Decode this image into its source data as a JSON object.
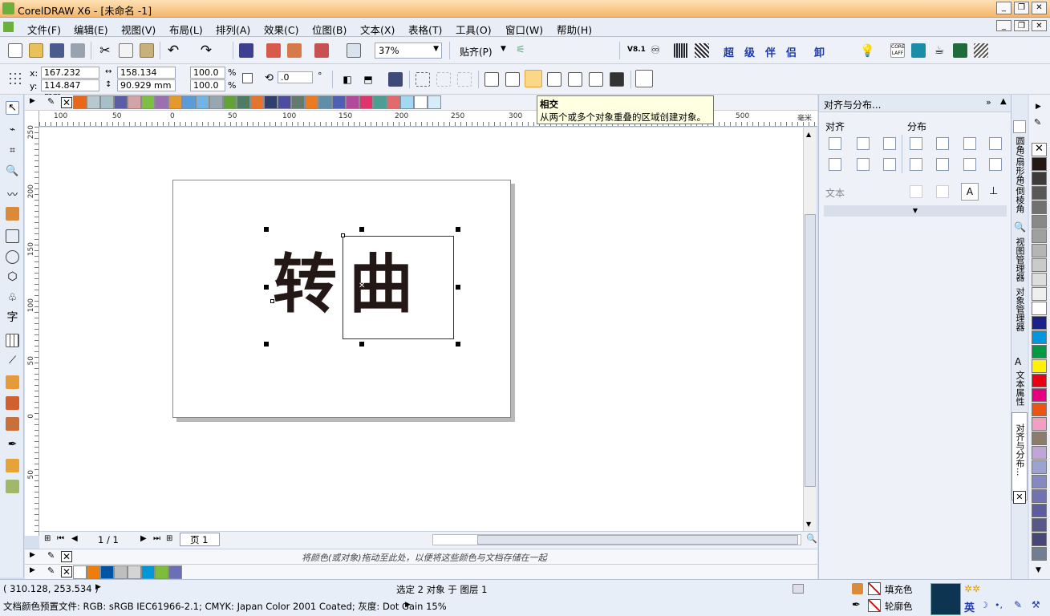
{
  "app": {
    "title": "CorelDRAW X6 - [未命名 -1]"
  },
  "menu": [
    "文件(F)",
    "编辑(E)",
    "视图(V)",
    "布局(L)",
    "排列(A)",
    "效果(C)",
    "位图(B)",
    "文本(X)",
    "表格(T)",
    "工具(O)",
    "窗口(W)",
    "帮助(H)"
  ],
  "toolbar": {
    "zoom": "37%",
    "snap": "贴齐(P)",
    "version_label": "V8.1",
    "char_buttons": [
      "超",
      "级",
      "伴",
      "侣",
      "卸"
    ]
  },
  "property_bar": {
    "x_label": "x:",
    "y_label": "y:",
    "x": "167.232 mm",
    "y": "114.847 mm",
    "width": "158.134 mm",
    "height": "90.929 mm",
    "scale_x": "100.0",
    "scale_y": "100.0",
    "percent": "%",
    "rotation": ".0",
    "degree": "°"
  },
  "hruler_ticks": [
    "100",
    "50",
    "0",
    "50",
    "100",
    "150",
    "200",
    "250",
    "300",
    "500",
    "毫米"
  ],
  "vruler_ticks": [
    "250",
    "200",
    "150",
    "100",
    "50",
    "0",
    "50"
  ],
  "canvas": {
    "char1": "转",
    "char2": "曲"
  },
  "tooltip": {
    "title": "相交",
    "desc": "从两个或多个对象重叠的区域创建对象。"
  },
  "docker": {
    "title": "对齐与分布...",
    "align_label": "对齐",
    "distribute_label": "分布",
    "text_label": "文本"
  },
  "docker_tabs": [
    "圆角/扇形角/倒棱角",
    "视图管理器",
    "对象管理器",
    "文本属性",
    "对齐与分布..."
  ],
  "page": {
    "counter": "1 / 1",
    "tab": "页 1"
  },
  "doc_palette": {
    "hint": "将颜色(或对象)拖动至此处，以便将这些颜色与文档存储在一起"
  },
  "status": {
    "coords": "( 310.128, 253.534 )",
    "selection": "选定 2 对象 于 图层 1",
    "fill_label": "填充色",
    "outline_label": "轮廓色",
    "profile": "文档颜色预置文件: RGB: sRGB IEC61966-2.1; CMYK: Japan Color 2001 Coated; 灰度: Dot Gain 15%",
    "ime": "英"
  },
  "colors": {
    "top_palette": [
      "#e8681a",
      "#b7c9cf",
      "#a9bfc7",
      "#5b5ea6",
      "#d4a3a6",
      "#7cbf45",
      "#9c6fae",
      "#e39a2b",
      "#5c9bd5",
      "#74b4e3",
      "#9aa6ad",
      "#61a339",
      "#4f7b62",
      "#e4752f",
      "#323f6c",
      "#4d4da0",
      "#637a70",
      "#ec7a23",
      "#5e8fa6",
      "#4e5fb4",
      "#b14a9b",
      "#e0356c",
      "#4c9e92",
      "#e26a6a",
      "#a4d7f0",
      "#ffffff",
      "#d6ecfa"
    ],
    "doc_palette": [
      "#ffffff",
      "#ef7d0c",
      "#0054a6",
      "#bebebe",
      "#d4d4d4",
      "#0097d8",
      "#7cbd3c",
      "#6970b8"
    ],
    "right_palette": [
      "#231815",
      "#3e3a39",
      "#595757",
      "#727171",
      "#898989",
      "#9fa0a0",
      "#b5b5b6",
      "#c9caca",
      "#dcdddd",
      "#efefef",
      "#ffffff",
      "#1d2088",
      "#0097e0",
      "#009944",
      "#fff100",
      "#e60012",
      "#e4007f",
      "#ea5514",
      "#f19ec2",
      "#8c7c6b",
      "#bfa6d6",
      "#9aa3d1",
      "#8688c2",
      "#7173b0",
      "#5c5c9e",
      "#57578a",
      "#474775",
      "#6f7e93"
    ]
  }
}
